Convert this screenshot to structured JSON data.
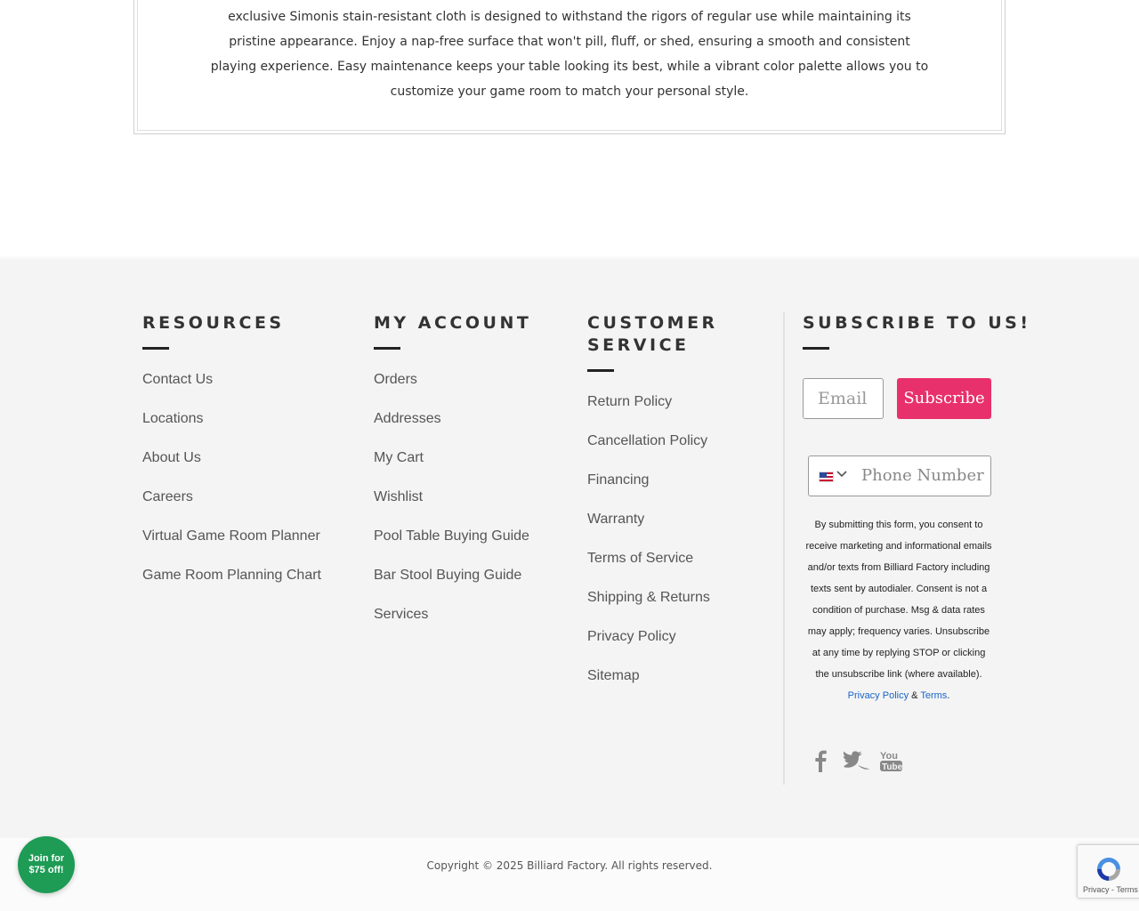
{
  "description": {
    "text": "exclusive Simonis stain-resistant cloth is designed to withstand the rigors of regular use while maintaining its pristine appearance. Enjoy a nap-free surface that won't pill, fluff, or shed, ensuring a smooth and consistent playing experience. Easy maintenance keeps your table looking its best, while a vibrant color palette allows you to customize your game room to match your personal style."
  },
  "footer": {
    "resources": {
      "title": "RESOURCES",
      "links": [
        "Contact Us",
        "Locations",
        "About Us",
        "Careers",
        "Virtual Game Room Planner",
        "Game Room Planning Chart"
      ]
    },
    "account": {
      "title": "MY ACCOUNT",
      "links": [
        "Orders",
        "Addresses",
        "My Cart",
        "Wishlist",
        "Pool Table Buying Guide",
        "Bar Stool Buying Guide",
        "Services"
      ]
    },
    "customer_service": {
      "title_line1": "CUSTOMER",
      "title_line2": "SERVICE",
      "links": [
        "Return Policy",
        "Cancellation Policy",
        "Financing",
        "Warranty",
        "Terms of Service",
        "Shipping & Returns",
        "Privacy Policy",
        "Sitemap"
      ]
    },
    "subscribe": {
      "title": "SUBSCRIBE TO US!",
      "email_placeholder": "Email",
      "button_label": "Subscribe",
      "button_color": "#e8306d",
      "phone_placeholder": "Phone Number",
      "country_flag": "us-flag-icon",
      "consent_text": "By submitting this form, you consent to receive marketing and informational emails and/or texts from Billiard Factory including texts sent by autodialer. Consent is not a condition of purchase. Msg & data rates may apply; frequency varies. Unsubscribe at any time by replying STOP or clicking the unsubscribe link (where available).",
      "privacy_link": "Privacy Policy",
      "amp": "&",
      "terms_link": "Terms",
      "period": "."
    },
    "social": [
      "facebook-icon",
      "twitter-icon",
      "youtube-icon"
    ]
  },
  "bottom": {
    "copyright": "Copyright © 2025 Billiard Factory. All rights reserved."
  },
  "promo": {
    "line1": "Join for",
    "line2": "$75 off!",
    "color": "#1e9b55"
  },
  "recaptcha": {
    "privacy": "Privacy",
    "sep": "-",
    "terms": "Terms"
  }
}
